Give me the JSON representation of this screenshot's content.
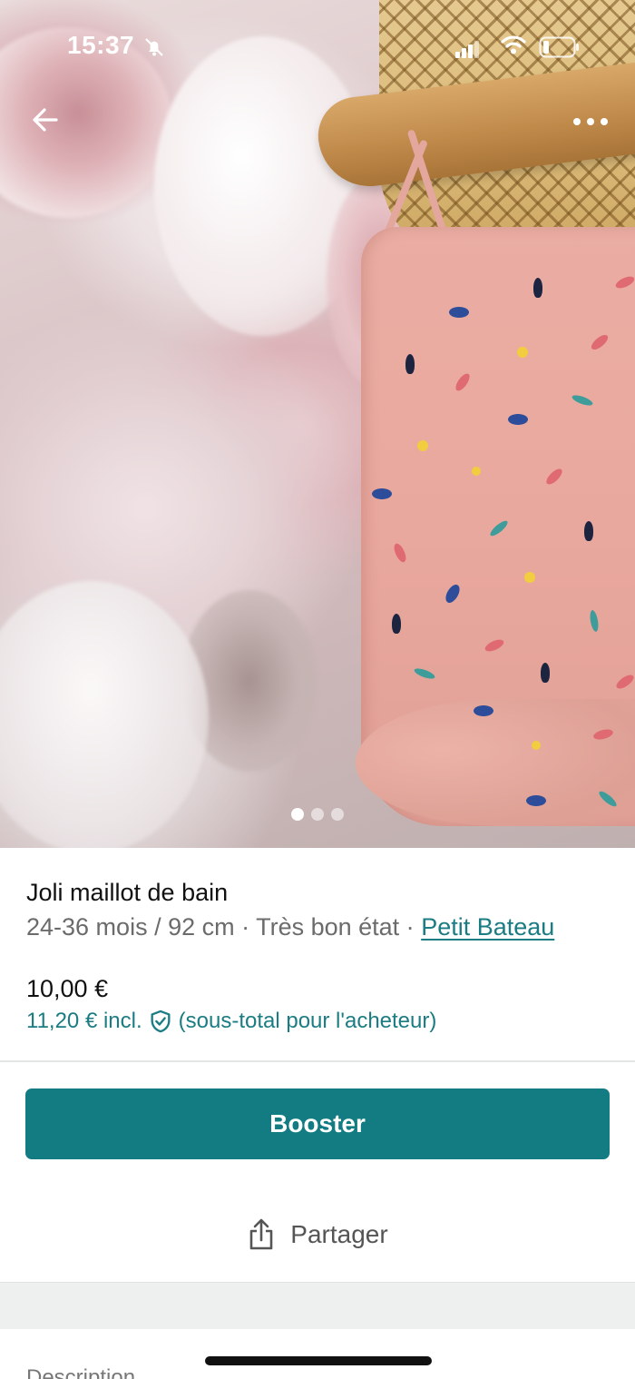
{
  "status_bar": {
    "time": "15:37",
    "icons": [
      "bell-slash-icon",
      "signal-icon",
      "wifi-icon",
      "battery-icon"
    ]
  },
  "nav": {
    "back_icon": "arrow-left-icon",
    "more_icon": "more-horizontal-icon"
  },
  "gallery": {
    "photo_count": 3,
    "active_index": 0
  },
  "product": {
    "title": "Joli maillot de bain",
    "meta_prefix": "24-36 mois / 92 cm · Très bon état · ",
    "brand": "Petit Bateau",
    "price": "10,00 €",
    "buyer_price": "11,20 € incl.",
    "buyer_price_note": "(sous-total pour l'acheteur)",
    "protection_icon": "shield-check-icon"
  },
  "actions": {
    "booster_label": "Booster",
    "share_label": "Partager",
    "share_icon": "share-icon"
  },
  "section": {
    "description_label": "Description"
  },
  "colors": {
    "accent": "#137c83",
    "link": "#1b7c83",
    "muted_text": "#6b6b6b"
  }
}
